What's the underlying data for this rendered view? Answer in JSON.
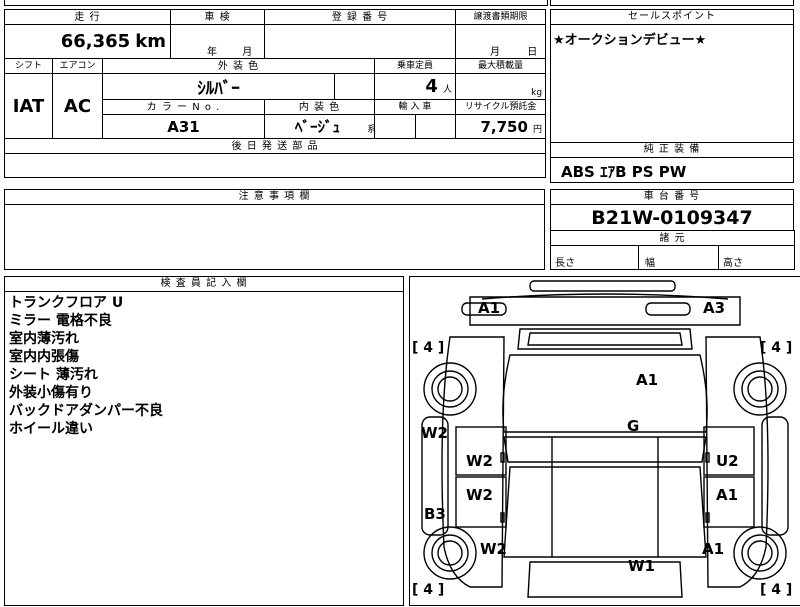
{
  "top_strip": {
    "partial_text": "■■■■"
  },
  "main": {
    "headers": {
      "mileage": "走 行",
      "inspection": "車 検",
      "registration": "登 録 番 号",
      "transfer_deadline": "譲渡書類期限",
      "shift": "シフト",
      "aircon": "エアコン",
      "exterior_color": "外 装 色",
      "capacity": "乗車定員",
      "max_load": "最大積載量",
      "color_no": "カ ラ ー N o .",
      "interior_color": "内 装 色",
      "import": "輸 入 車",
      "recycle_fee": "リサイクル預託金",
      "later_parts": "後 日 発 送 部 品"
    },
    "values": {
      "mileage": "66,365",
      "mileage_unit": "km",
      "inspection_year": "年",
      "inspection_month": "月",
      "transfer_month": "月",
      "transfer_day": "日",
      "shift": "IAT",
      "aircon": "AC",
      "exterior_color": "ｼﾙﾊﾞｰ",
      "capacity": "4",
      "capacity_unit": "人",
      "load_unit": "kg",
      "color_no": "A31",
      "interior_color": "ﾍﾞｰｼﾞｭ",
      "interior_suffix": "系",
      "recycle_fee": "7,750",
      "recycle_unit": "円"
    }
  },
  "sales_point": {
    "header": "セールスポイント",
    "text": "★オークションデビュー★"
  },
  "standard_equipment": {
    "header": "純 正 装 備",
    "text": "ABS ｴｱB PS PW"
  },
  "notes": {
    "header": "注 意 事 項 欄"
  },
  "chassis": {
    "header": "車 台 番 号",
    "number": "B21W-0109347"
  },
  "dimensions": {
    "header": "諸 元",
    "length": "長さ",
    "width": "幅",
    "height": "高さ"
  },
  "inspector": {
    "header": "検 査 員 記 入 欄",
    "lines": [
      "トランクフロア U",
      "ミラー 電格不良",
      "室内薄汚れ",
      "室内内張傷",
      "シート 薄汚れ",
      "外装小傷有り",
      "バックドアダンパー不良",
      "ホイール違い"
    ]
  },
  "diagram": {
    "marks": {
      "rear_left": "A1",
      "rear_right": "A3",
      "roof": "A1",
      "glass": "G",
      "left_quarter": "W2",
      "left_rear_door": "W2",
      "right_rear_door": "U2",
      "left_front_door": "W2",
      "right_front_door": "A1",
      "left_fender": "W2",
      "right_fender": "A1",
      "left_sill": "B3",
      "hood": "W1"
    },
    "tires": {
      "rear_left": "4",
      "rear_right": "4",
      "front_left": "4",
      "front_right": "4"
    }
  }
}
